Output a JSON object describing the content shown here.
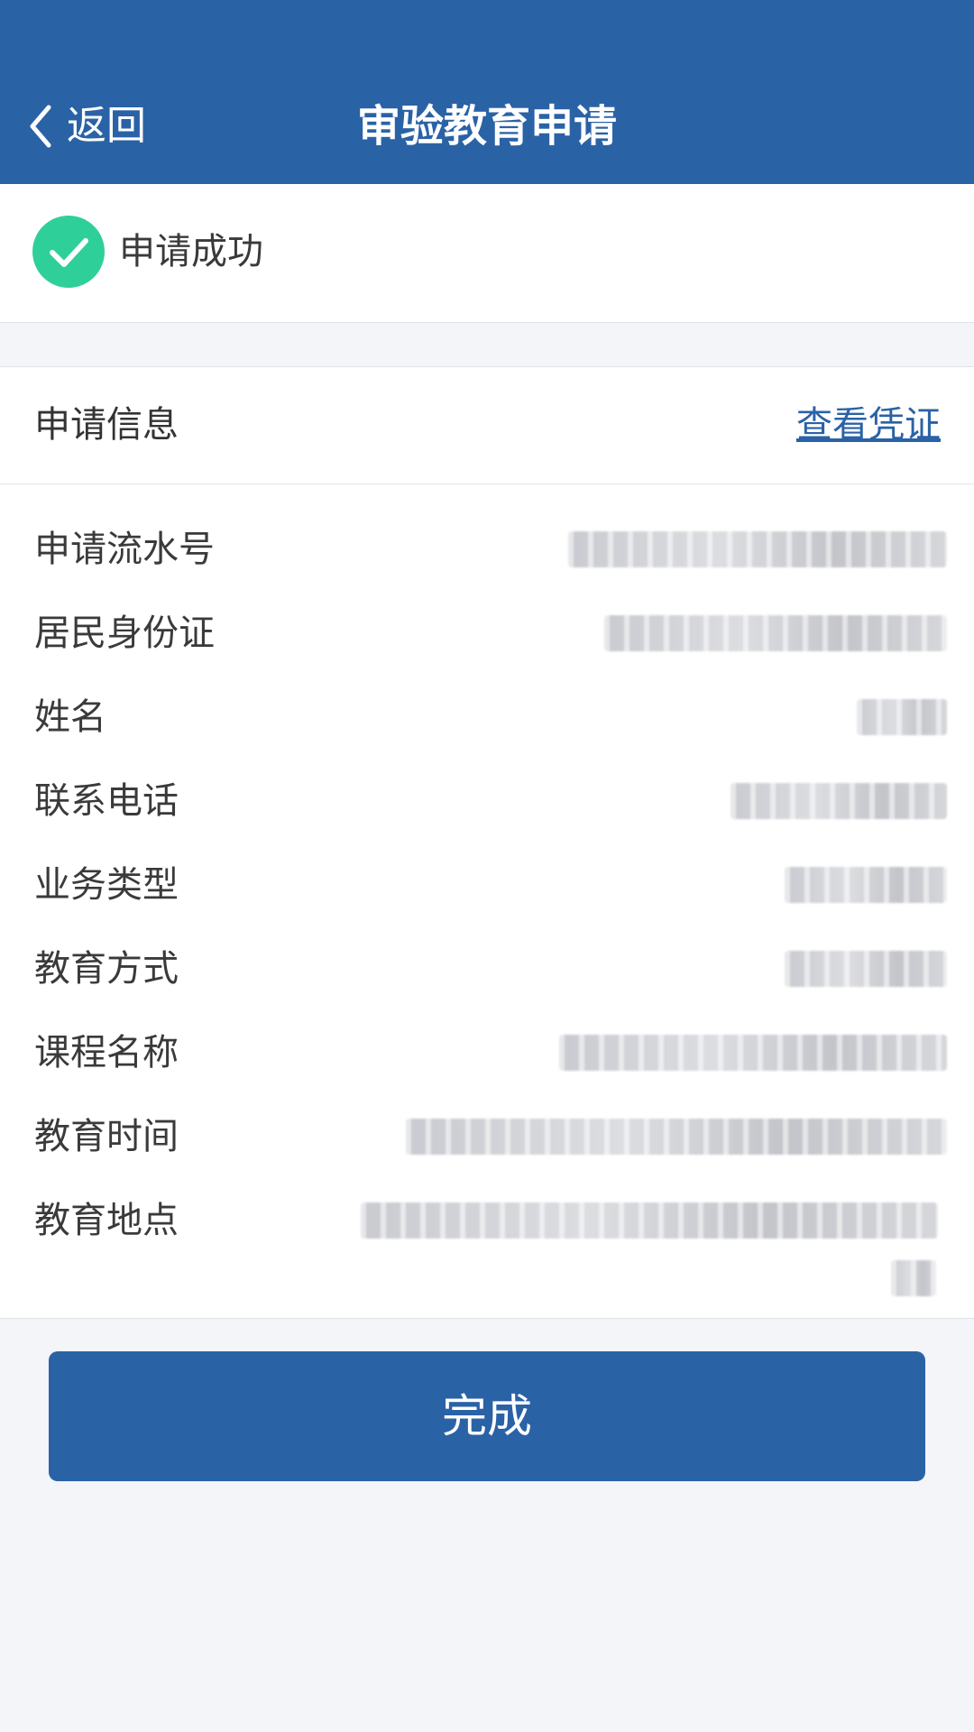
{
  "header": {
    "back_label": "返回",
    "title": "审验教育申请"
  },
  "status": {
    "text": "申请成功",
    "icon": "check-circle-icon",
    "color": "#2fcf9a"
  },
  "info": {
    "title": "申请信息",
    "voucher_link": "查看凭证",
    "fields": [
      {
        "label": "申请流水号"
      },
      {
        "label": "居民身份证"
      },
      {
        "label": "姓名"
      },
      {
        "label": "联系电话"
      },
      {
        "label": "业务类型"
      },
      {
        "label": "教育方式"
      },
      {
        "label": "课程名称"
      },
      {
        "label": "教育时间"
      },
      {
        "label": "教育地点"
      }
    ]
  },
  "actions": {
    "done_label": "完成"
  },
  "colors": {
    "primary": "#2a62a6",
    "background": "#f3f5f9",
    "success": "#2fcf9a"
  }
}
